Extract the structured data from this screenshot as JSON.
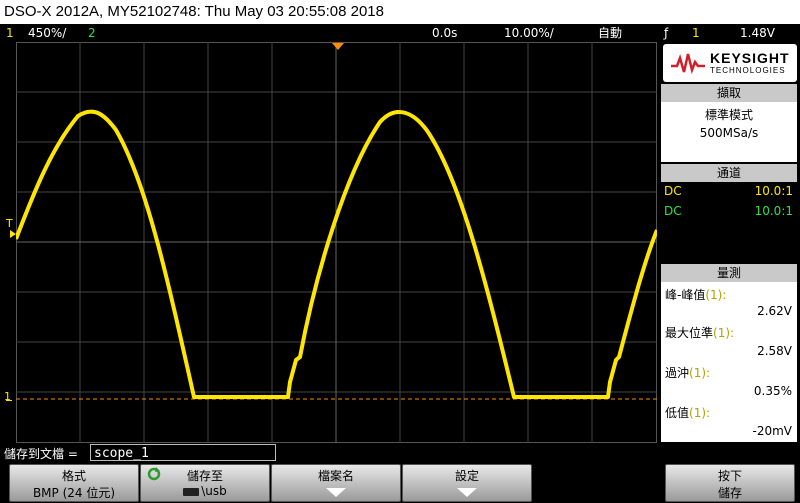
{
  "title": "DSO-X 2012A, MY52102748: Thu May 03 20:55:08 2018",
  "status": {
    "ch1_num": "1",
    "ch1_scale": "450%/",
    "ch2_num": "2",
    "time_pos": "0.0s",
    "time_scale": "10.00%/",
    "trigger_mode": "自動",
    "trigger_icon": "ƒ",
    "trigger_src": "1",
    "trigger_level": "1.48V"
  },
  "markers": {
    "trigger": "T",
    "ch1": "1"
  },
  "brand": {
    "name": "KEYSIGHT",
    "sub": "TECHNOLOGIES"
  },
  "acquire": {
    "header": "擷取",
    "mode": "標準模式",
    "rate": "500MSa/s"
  },
  "channels": {
    "header": "通道",
    "rows": [
      {
        "coupling": "DC",
        "probe": "10.0:1"
      },
      {
        "coupling": "DC",
        "probe": "10.0:1"
      }
    ]
  },
  "measure": {
    "header": "量測",
    "items": [
      {
        "name": "峰-峰值",
        "src": "(1):",
        "value": "2.62V"
      },
      {
        "name": "最大位準",
        "src": "(1):",
        "value": "2.58V"
      },
      {
        "name": "過沖",
        "src": "(1):",
        "value": "0.35%"
      },
      {
        "name": "低值",
        "src": "(1):",
        "value": "-20mV"
      }
    ]
  },
  "save": {
    "label": "儲存到文檔 =",
    "filename": "scope_1"
  },
  "softkeys": [
    {
      "top": "格式",
      "bottom": "BMP (24 位元)"
    },
    {
      "top": "儲存至",
      "bottom": "\\usb"
    },
    {
      "top": "檔案名",
      "bottom": ""
    },
    {
      "top": "設定",
      "bottom": ""
    },
    {
      "top": "按下",
      "bottom": "儲存"
    }
  ],
  "colors": {
    "ch1": "#ffe600",
    "ch2": "#2ee04a",
    "grid": "#555555",
    "trigger_marker": "#ff8c00"
  }
}
